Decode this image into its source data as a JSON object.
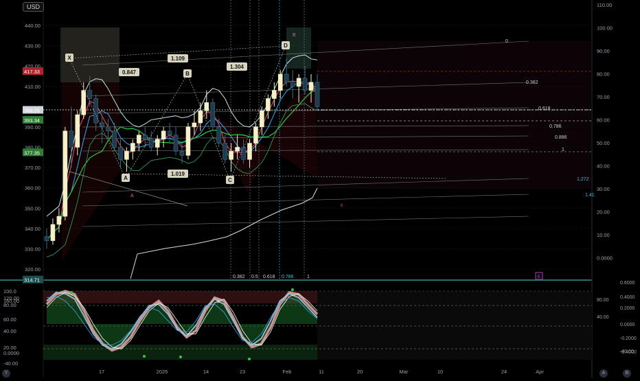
{
  "currency_badge": "USD",
  "corner_left": "Y",
  "corner_right_a": "A",
  "corner_right_b": "B",
  "colors": {
    "bull": "#f5f0c8",
    "bear": "#1f3b4d",
    "ema_fast": "#e94f6d",
    "ema_mid": "#3fa9f5",
    "ema_slow": "#2ecc40",
    "envelope": "#c8e6e6",
    "pattern": "#9aa6a0",
    "fib": "#c9d1d9",
    "white_line": "#dddddd",
    "teal_line": "#26c6da",
    "zone": "#3d6e5c"
  },
  "chart_data": [
    {
      "type": "candlestick",
      "title": "",
      "price_unit": "USD",
      "x_ticks": [
        "17",
        "2025",
        "14",
        "23",
        "Feb",
        "11",
        "20",
        "Mar",
        "10",
        "24",
        "Apr"
      ],
      "left_axis_ticks": [
        "440.00",
        "430.00",
        "420.00",
        "410.00",
        "390.00",
        "380.00",
        "370.00",
        "360.00",
        "350.00",
        "340.00",
        "330.00",
        "320.00"
      ],
      "right_axis_ticks": [
        "110.00",
        "100.00",
        "90.00",
        "80.00",
        "70.00",
        "60.00",
        "50.00",
        "40.00",
        "30.00",
        "20.00",
        "10.00",
        "0.0000"
      ],
      "price_labels": [
        {
          "text": "417.33",
          "value": 417.33,
          "color": "#b2222b"
        },
        {
          "text": "398.26",
          "value": 398.26,
          "color": "#d1d4dc"
        },
        {
          "text": "393.34",
          "value": 393.34,
          "color": "#2e7d32"
        },
        {
          "text": "377.35",
          "value": 377.35,
          "color": "#2e7d32"
        },
        {
          "text": "314.71",
          "value": 314.71,
          "color": "#1b4f52"
        }
      ],
      "candles": [
        [
          336,
          340,
          330,
          334
        ],
        [
          334,
          345,
          332,
          342
        ],
        [
          342,
          350,
          338,
          346
        ],
        [
          346,
          390,
          344,
          388
        ],
        [
          388,
          400,
          370,
          380
        ],
        [
          380,
          398,
          376,
          396
        ],
        [
          396,
          412,
          394,
          408
        ],
        [
          408,
          415,
          400,
          404
        ],
        [
          404,
          406,
          388,
          392
        ],
        [
          392,
          396,
          382,
          390
        ],
        [
          390,
          394,
          384,
          388
        ],
        [
          388,
          392,
          378,
          380
        ],
        [
          380,
          384,
          370,
          374
        ],
        [
          374,
          380,
          368,
          378
        ],
        [
          378,
          384,
          374,
          382
        ],
        [
          382,
          388,
          378,
          386
        ],
        [
          386,
          390,
          380,
          384
        ],
        [
          384,
          388,
          378,
          380
        ],
        [
          380,
          386,
          376,
          384
        ],
        [
          384,
          390,
          380,
          388
        ],
        [
          388,
          392,
          382,
          386
        ],
        [
          386,
          390,
          376,
          378
        ],
        [
          378,
          382,
          372,
          376
        ],
        [
          376,
          392,
          374,
          390
        ],
        [
          390,
          398,
          386,
          392
        ],
        [
          392,
          402,
          388,
          398
        ],
        [
          398,
          408,
          394,
          402
        ],
        [
          402,
          404,
          388,
          390
        ],
        [
          390,
          394,
          380,
          382
        ],
        [
          382,
          386,
          372,
          374
        ],
        [
          374,
          382,
          368,
          378
        ],
        [
          378,
          386,
          374,
          380
        ],
        [
          380,
          384,
          372,
          374
        ],
        [
          374,
          384,
          370,
          382
        ],
        [
          382,
          392,
          378,
          390
        ],
        [
          390,
          400,
          386,
          398
        ],
        [
          398,
          406,
          394,
          404
        ],
        [
          404,
          412,
          400,
          408
        ],
        [
          408,
          418,
          404,
          416
        ],
        [
          416,
          424,
          410,
          412
        ],
        [
          412,
          418,
          404,
          410
        ],
        [
          410,
          416,
          402,
          414
        ],
        [
          414,
          420,
          406,
          408
        ],
        [
          408,
          416,
          402,
          412
        ],
        [
          412,
          416,
          398,
          400
        ]
      ],
      "harmonic_pattern": {
        "points": [
          {
            "label": "X",
            "value": 423
          },
          {
            "label": "A",
            "value": 367
          },
          {
            "label": "B",
            "value": 414
          },
          {
            "label": "C",
            "value": 364
          },
          {
            "label": "D",
            "value": 427
          }
        ],
        "ratios": [
          "1.109",
          "0.847",
          "1.304",
          "1.019"
        ],
        "zone_label": "B"
      },
      "fib_projection_labels": [
        "0",
        "0.382",
        "0.618",
        "0.786",
        "0.886",
        "1",
        "1.272",
        "1.41"
      ],
      "fib_time_labels": [
        "0.382",
        "0.5",
        "0.618",
        "0.786",
        "1"
      ],
      "misc_labels": {
        "A": "A",
        "c": "c",
        "E": "E"
      }
    },
    {
      "type": "line",
      "title": "",
      "left_axis_ticks": [
        "160.00",
        "120.00",
        "100.0",
        "80.00",
        "60.00",
        "40.00",
        "20.00",
        "0.0000",
        "-40.00"
      ],
      "right_axis_ticks": [
        "0.6000",
        "0.4000",
        "80.00",
        "0.2000",
        "40.00",
        "0.0000",
        "-0.2000",
        "-40.00",
        "-0.4000"
      ],
      "series": [
        {
          "values": [
            80,
            95,
            100,
            95,
            70,
            40,
            20,
            10,
            15,
            30,
            55,
            75,
            85,
            70,
            45,
            30,
            40,
            70,
            90,
            85,
            60,
            30,
            15,
            20,
            45,
            80,
            98,
            95,
            80,
            65
          ]
        },
        {
          "values": [
            85,
            98,
            96,
            88,
            62,
            35,
            18,
            12,
            20,
            38,
            60,
            78,
            80,
            65,
            42,
            32,
            48,
            75,
            88,
            80,
            55,
            28,
            18,
            28,
            55,
            85,
            96,
            90,
            75,
            60
          ]
        },
        {
          "values": [
            75,
            90,
            98,
            92,
            75,
            50,
            28,
            15,
            12,
            25,
            48,
            70,
            82,
            75,
            55,
            35,
            35,
            60,
            82,
            88,
            68,
            40,
            20,
            18,
            38,
            72,
            92,
            96,
            85,
            70
          ]
        },
        {
          "values": [
            90,
            92,
            85,
            70,
            50,
            30,
            20,
            18,
            25,
            40,
            62,
            75,
            70,
            55,
            40,
            38,
            55,
            78,
            80,
            68,
            45,
            25,
            22,
            35,
            60,
            82,
            90,
            85,
            70,
            58
          ]
        }
      ]
    }
  ]
}
